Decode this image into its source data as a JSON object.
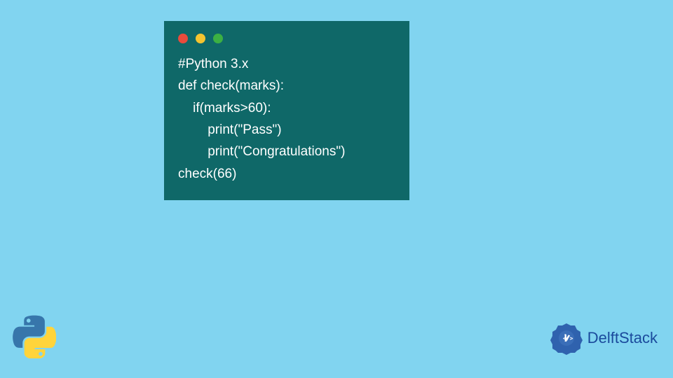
{
  "code_window": {
    "lines": [
      "#Python 3.x",
      "def check(marks):",
      "    if(marks>60):",
      "        print(\"Pass\")",
      "        print(\"Congratulations\")",
      "check(66)"
    ]
  },
  "branding": {
    "name": "DelftStack"
  },
  "colors": {
    "background": "#81d4f0",
    "code_bg": "#0f6868",
    "code_text": "#ffffff",
    "brand_blue": "#1a4a9c"
  }
}
